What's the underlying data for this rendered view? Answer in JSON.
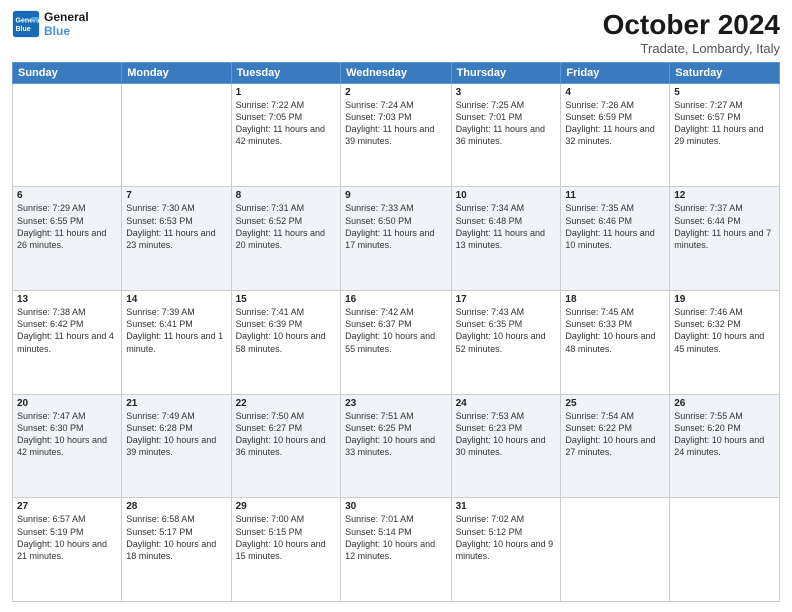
{
  "header": {
    "logo_line1": "General",
    "logo_line2": "Blue",
    "title": "October 2024",
    "subtitle": "Tradate, Lombardy, Italy"
  },
  "days_of_week": [
    "Sunday",
    "Monday",
    "Tuesday",
    "Wednesday",
    "Thursday",
    "Friday",
    "Saturday"
  ],
  "weeks": [
    [
      {
        "day": "",
        "info": ""
      },
      {
        "day": "",
        "info": ""
      },
      {
        "day": "1",
        "info": "Sunrise: 7:22 AM\nSunset: 7:05 PM\nDaylight: 11 hours and 42 minutes."
      },
      {
        "day": "2",
        "info": "Sunrise: 7:24 AM\nSunset: 7:03 PM\nDaylight: 11 hours and 39 minutes."
      },
      {
        "day": "3",
        "info": "Sunrise: 7:25 AM\nSunset: 7:01 PM\nDaylight: 11 hours and 36 minutes."
      },
      {
        "day": "4",
        "info": "Sunrise: 7:26 AM\nSunset: 6:59 PM\nDaylight: 11 hours and 32 minutes."
      },
      {
        "day": "5",
        "info": "Sunrise: 7:27 AM\nSunset: 6:57 PM\nDaylight: 11 hours and 29 minutes."
      }
    ],
    [
      {
        "day": "6",
        "info": "Sunrise: 7:29 AM\nSunset: 6:55 PM\nDaylight: 11 hours and 26 minutes."
      },
      {
        "day": "7",
        "info": "Sunrise: 7:30 AM\nSunset: 6:53 PM\nDaylight: 11 hours and 23 minutes."
      },
      {
        "day": "8",
        "info": "Sunrise: 7:31 AM\nSunset: 6:52 PM\nDaylight: 11 hours and 20 minutes."
      },
      {
        "day": "9",
        "info": "Sunrise: 7:33 AM\nSunset: 6:50 PM\nDaylight: 11 hours and 17 minutes."
      },
      {
        "day": "10",
        "info": "Sunrise: 7:34 AM\nSunset: 6:48 PM\nDaylight: 11 hours and 13 minutes."
      },
      {
        "day": "11",
        "info": "Sunrise: 7:35 AM\nSunset: 6:46 PM\nDaylight: 11 hours and 10 minutes."
      },
      {
        "day": "12",
        "info": "Sunrise: 7:37 AM\nSunset: 6:44 PM\nDaylight: 11 hours and 7 minutes."
      }
    ],
    [
      {
        "day": "13",
        "info": "Sunrise: 7:38 AM\nSunset: 6:42 PM\nDaylight: 11 hours and 4 minutes."
      },
      {
        "day": "14",
        "info": "Sunrise: 7:39 AM\nSunset: 6:41 PM\nDaylight: 11 hours and 1 minute."
      },
      {
        "day": "15",
        "info": "Sunrise: 7:41 AM\nSunset: 6:39 PM\nDaylight: 10 hours and 58 minutes."
      },
      {
        "day": "16",
        "info": "Sunrise: 7:42 AM\nSunset: 6:37 PM\nDaylight: 10 hours and 55 minutes."
      },
      {
        "day": "17",
        "info": "Sunrise: 7:43 AM\nSunset: 6:35 PM\nDaylight: 10 hours and 52 minutes."
      },
      {
        "day": "18",
        "info": "Sunrise: 7:45 AM\nSunset: 6:33 PM\nDaylight: 10 hours and 48 minutes."
      },
      {
        "day": "19",
        "info": "Sunrise: 7:46 AM\nSunset: 6:32 PM\nDaylight: 10 hours and 45 minutes."
      }
    ],
    [
      {
        "day": "20",
        "info": "Sunrise: 7:47 AM\nSunset: 6:30 PM\nDaylight: 10 hours and 42 minutes."
      },
      {
        "day": "21",
        "info": "Sunrise: 7:49 AM\nSunset: 6:28 PM\nDaylight: 10 hours and 39 minutes."
      },
      {
        "day": "22",
        "info": "Sunrise: 7:50 AM\nSunset: 6:27 PM\nDaylight: 10 hours and 36 minutes."
      },
      {
        "day": "23",
        "info": "Sunrise: 7:51 AM\nSunset: 6:25 PM\nDaylight: 10 hours and 33 minutes."
      },
      {
        "day": "24",
        "info": "Sunrise: 7:53 AM\nSunset: 6:23 PM\nDaylight: 10 hours and 30 minutes."
      },
      {
        "day": "25",
        "info": "Sunrise: 7:54 AM\nSunset: 6:22 PM\nDaylight: 10 hours and 27 minutes."
      },
      {
        "day": "26",
        "info": "Sunrise: 7:55 AM\nSunset: 6:20 PM\nDaylight: 10 hours and 24 minutes."
      }
    ],
    [
      {
        "day": "27",
        "info": "Sunrise: 6:57 AM\nSunset: 5:19 PM\nDaylight: 10 hours and 21 minutes."
      },
      {
        "day": "28",
        "info": "Sunrise: 6:58 AM\nSunset: 5:17 PM\nDaylight: 10 hours and 18 minutes."
      },
      {
        "day": "29",
        "info": "Sunrise: 7:00 AM\nSunset: 5:15 PM\nDaylight: 10 hours and 15 minutes."
      },
      {
        "day": "30",
        "info": "Sunrise: 7:01 AM\nSunset: 5:14 PM\nDaylight: 10 hours and 12 minutes."
      },
      {
        "day": "31",
        "info": "Sunrise: 7:02 AM\nSunset: 5:12 PM\nDaylight: 10 hours and 9 minutes."
      },
      {
        "day": "",
        "info": ""
      },
      {
        "day": "",
        "info": ""
      }
    ]
  ]
}
